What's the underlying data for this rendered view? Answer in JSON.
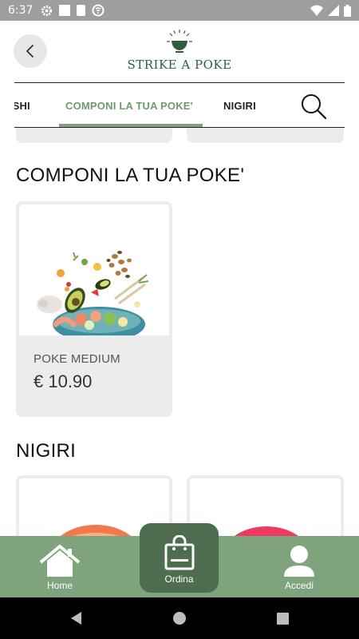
{
  "status_bar": {
    "time": "6:37"
  },
  "header": {
    "logo_text": "STRIKE A POKE",
    "back_icon": "chevron-left-icon"
  },
  "tabs": [
    {
      "label": "USHI",
      "active": false
    },
    {
      "label": "COMPONI LA TUA POKE'",
      "active": true
    },
    {
      "label": "NIGIRI",
      "active": false
    }
  ],
  "sections": [
    {
      "title": "COMPONI LA TUA POKE'",
      "items": [
        {
          "name": "POKE MEDIUM",
          "price": "€ 10.90"
        }
      ]
    },
    {
      "title": "NIGIRI",
      "items": []
    }
  ],
  "bottom_nav": {
    "home": {
      "label": "Home",
      "icon": "house-icon"
    },
    "order": {
      "label": "Ordina",
      "icon": "shopping-bag-icon"
    },
    "login": {
      "label": "Accedi",
      "icon": "user-icon"
    }
  },
  "colors": {
    "accent_green": "#7fa37d",
    "dark_green": "#4e6d4f",
    "logo_green": "#2f5d3e",
    "card_bg": "#ececec"
  }
}
